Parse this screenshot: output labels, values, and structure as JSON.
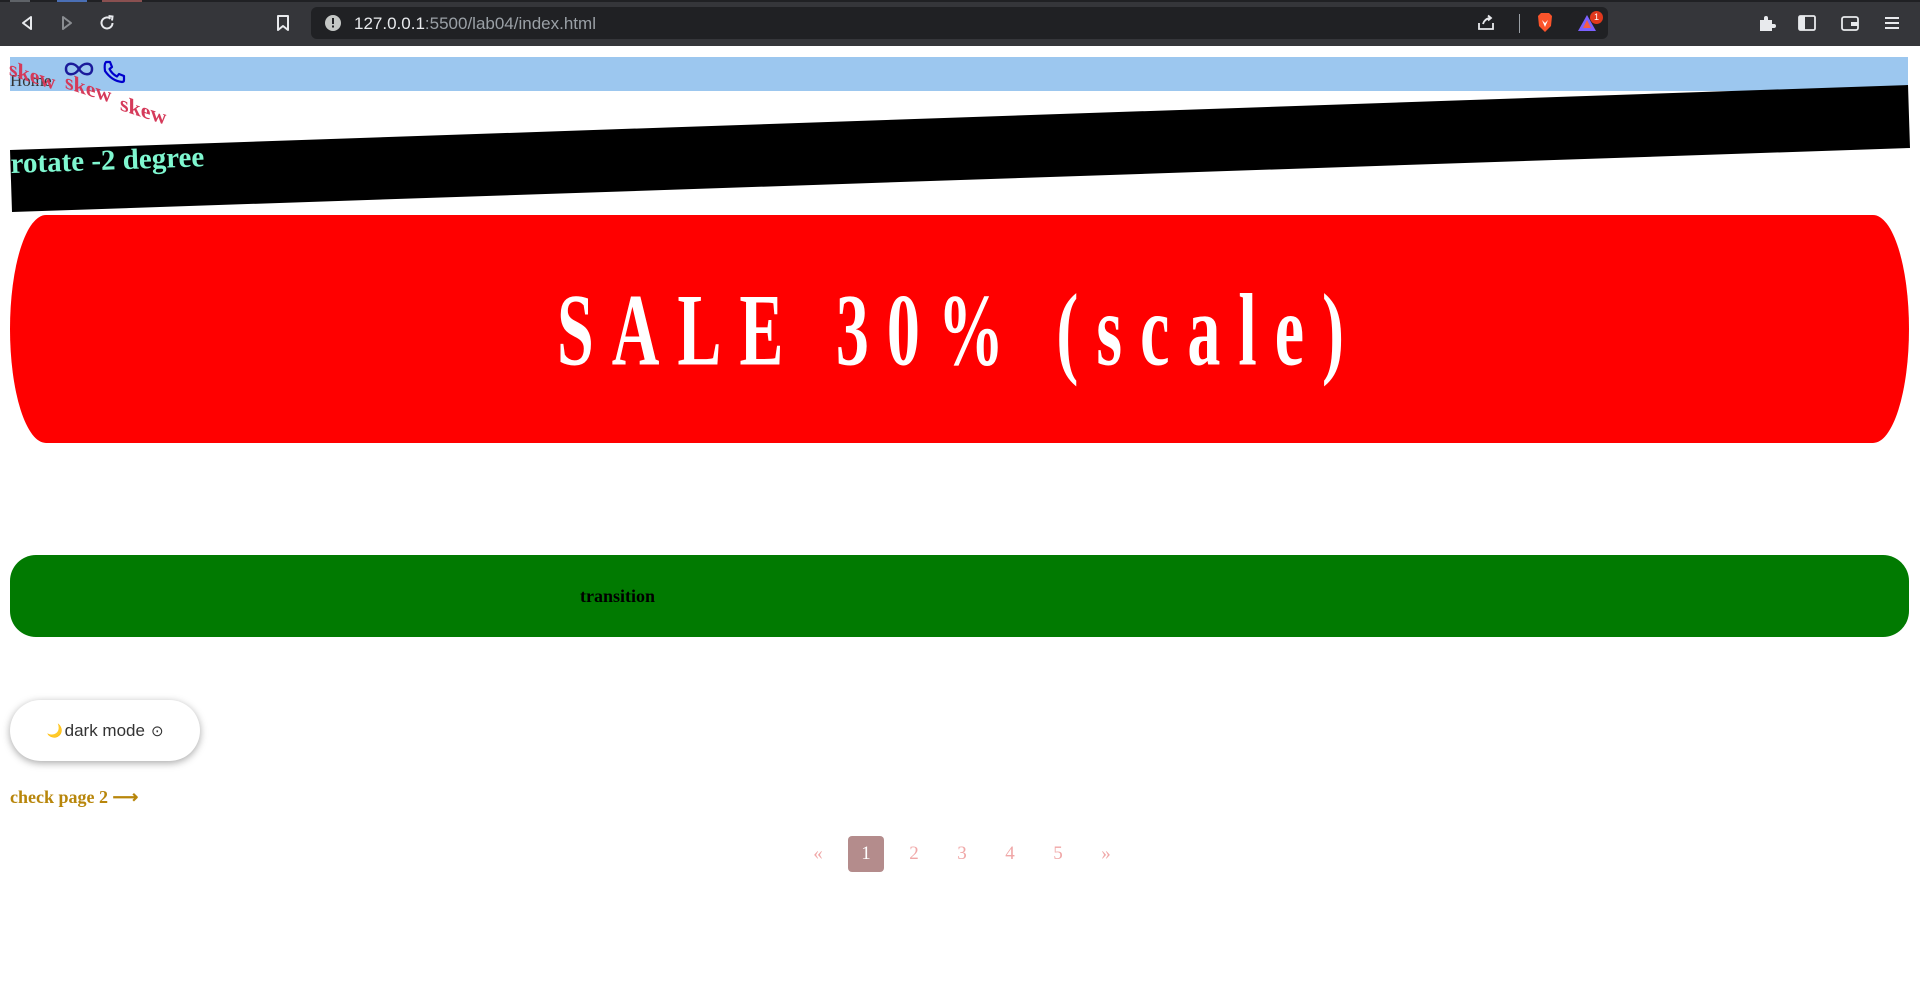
{
  "browser": {
    "url_host": "127.0.0.1",
    "url_rest": ":5500/lab04/index.html",
    "notification_count": "1"
  },
  "navbar": {
    "home_label": "Home"
  },
  "skew": {
    "words": [
      "skew",
      "skew",
      "skew"
    ]
  },
  "rotate": {
    "label": "rotate -2 degree"
  },
  "sale": {
    "label": "SALE 30% (scale)"
  },
  "transition": {
    "label": "transition"
  },
  "dark_mode": {
    "label": "dark mode",
    "moon_icon": "🌙",
    "toggle_icon": "⊙"
  },
  "page2_link": {
    "label": "check page 2 ⟶"
  },
  "pagination": {
    "prev": "«",
    "pages": [
      "1",
      "2",
      "3",
      "4",
      "5"
    ],
    "next": "»",
    "active": "1"
  },
  "colors": {
    "navbar_bg": "#9cc7ef",
    "skew_text": "#d53a5a",
    "rotate_bg": "#000000",
    "rotate_text": "#7ff7d0",
    "sale_bg": "#ff0000",
    "transition_bg": "#017a01",
    "link": "#b8860b",
    "page_active_bg": "#b48c8c",
    "page_text": "#f0a7a7"
  }
}
